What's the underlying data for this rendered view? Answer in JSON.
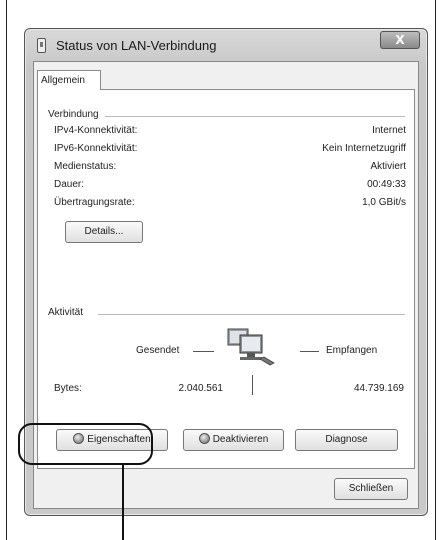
{
  "window": {
    "title": "Status von LAN-Verbindung",
    "close_label": "X"
  },
  "tabs": [
    {
      "label": "Allgemein"
    }
  ],
  "connection": {
    "heading": "Verbindung",
    "rows": [
      {
        "label": "IPv4-Konnektivität:",
        "value": "Internet"
      },
      {
        "label": "IPv6-Konnektivität:",
        "value": "Kein Internetzugriff"
      },
      {
        "label": "Medienstatus:",
        "value": "Aktiviert"
      },
      {
        "label": "Dauer:",
        "value": "00:49:33"
      },
      {
        "label": "Übertragungsrate:",
        "value": "1,0 GBit/s"
      }
    ],
    "details_label": "Details..."
  },
  "activity": {
    "heading": "Aktivität",
    "sent_label": "Gesendet",
    "received_label": "Empfangen",
    "bytes_label": "Bytes:",
    "bytes_sent": "2.040.561",
    "bytes_received": "44.739.169",
    "icon": "network-computers-icon"
  },
  "actions": {
    "properties_label": "Eigenschaften",
    "deactivate_label": "Deaktivieren",
    "diagnose_label": "Diagnose"
  },
  "footer": {
    "close_label": "Schließen"
  }
}
